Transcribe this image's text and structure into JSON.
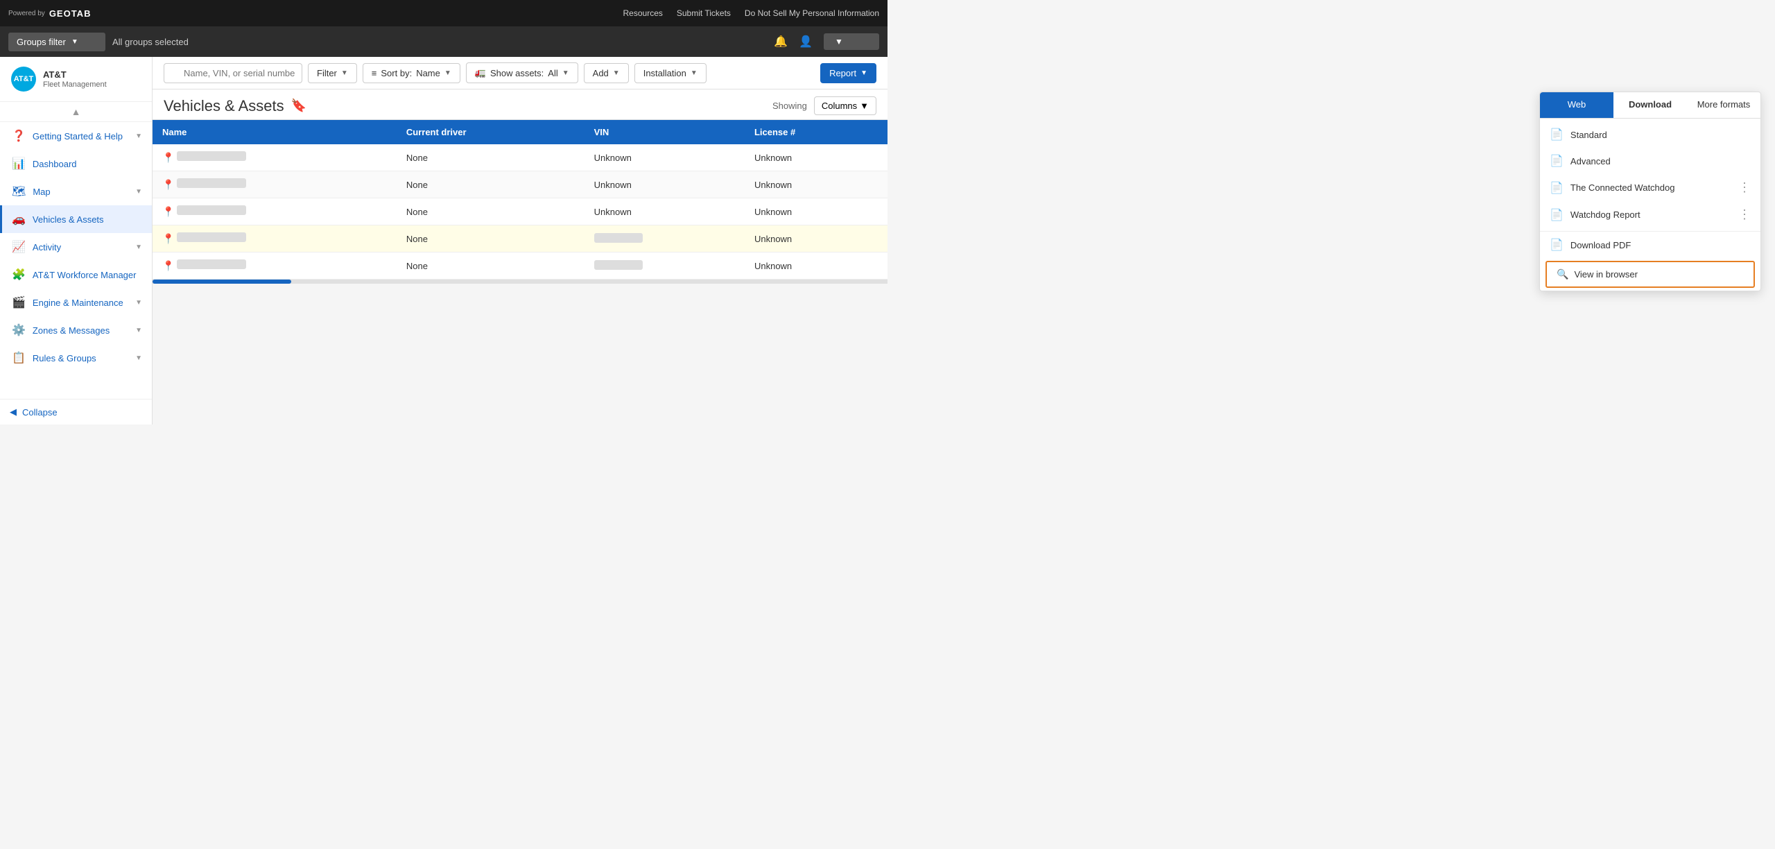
{
  "topbar": {
    "powered_by": "Powered by",
    "brand": "GEOTAB",
    "resources": "Resources",
    "submit_tickets": "Submit Tickets",
    "do_not_sell": "Do Not Sell My Personal Information"
  },
  "groups_bar": {
    "filter_label": "Groups filter",
    "selected_label": "All groups selected"
  },
  "sidebar": {
    "brand_name": "AT&T",
    "brand_sub": "Fleet Management",
    "items": [
      {
        "id": "getting-started",
        "label": "Getting Started & Help",
        "has_chevron": true
      },
      {
        "id": "dashboard",
        "label": "Dashboard",
        "has_chevron": false
      },
      {
        "id": "map",
        "label": "Map",
        "has_chevron": true
      },
      {
        "id": "vehicles",
        "label": "Vehicles & Assets",
        "has_chevron": false,
        "active": true
      },
      {
        "id": "activity",
        "label": "Activity",
        "has_chevron": true
      },
      {
        "id": "workforce",
        "label": "AT&T Workforce Manager",
        "has_chevron": false
      },
      {
        "id": "engine",
        "label": "Engine & Maintenance",
        "has_chevron": true
      },
      {
        "id": "zones",
        "label": "Zones & Messages",
        "has_chevron": true
      },
      {
        "id": "rules",
        "label": "Rules & Groups",
        "has_chevron": true
      }
    ],
    "collapse_label": "Collapse"
  },
  "toolbar": {
    "search_placeholder": "Name, VIN, or serial number",
    "filter_label": "Filter",
    "sort_label": "Sort by:",
    "sort_value": "Name",
    "show_assets_label": "Show assets:",
    "show_assets_value": "All",
    "add_label": "Add",
    "installation_label": "Installation",
    "report_label": "Report"
  },
  "page": {
    "title": "Vehicles & Assets",
    "showing_label": "Showing",
    "columns_label": "Columns"
  },
  "table": {
    "headers": [
      "Name",
      "Current driver",
      "VIN",
      "License #"
    ],
    "rows": [
      {
        "pin": "gray",
        "name": "",
        "driver": "None",
        "vin": "Unknown",
        "license": "Unknown",
        "highlighted": false
      },
      {
        "pin": "gray",
        "name": "",
        "driver": "None",
        "vin": "Unknown",
        "license": "Unknown",
        "highlighted": false
      },
      {
        "pin": "gray",
        "name": "",
        "driver": "None",
        "vin": "Unknown",
        "license": "Unknown",
        "highlighted": false
      },
      {
        "pin": "blue",
        "name": "",
        "driver": "None",
        "vin": "",
        "license": "Unknown",
        "extra": "",
        "highlighted": true
      },
      {
        "pin": "blue",
        "name": "",
        "driver": "None",
        "vin": "",
        "license": "Unknown",
        "extra": "",
        "highlighted": false
      }
    ]
  },
  "report_dropdown": {
    "tabs": [
      {
        "id": "web",
        "label": "Web",
        "active": true
      },
      {
        "id": "download",
        "label": "Download"
      },
      {
        "id": "more",
        "label": "More formats"
      }
    ],
    "download_items": [
      {
        "id": "pdf",
        "label": "Download PDF",
        "icon": "📄"
      },
      {
        "id": "view_browser",
        "label": "View in browser",
        "icon": "🔍"
      }
    ],
    "web_items": [
      {
        "id": "standard",
        "label": "Standard",
        "has_dots": false
      },
      {
        "id": "advanced",
        "label": "Advanced",
        "has_dots": false
      },
      {
        "id": "connected_watchdog",
        "label": "The Connected Watchdog",
        "has_dots": true
      },
      {
        "id": "watchdog_report",
        "label": "Watchdog Report",
        "has_dots": true
      }
    ]
  },
  "colors": {
    "primary_blue": "#1565c0",
    "highlight_orange": "#e67e22",
    "nav_bg": "#1a1a1a"
  }
}
